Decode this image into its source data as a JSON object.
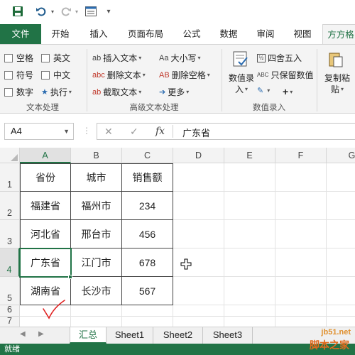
{
  "ribbon_tabs": [
    "文件",
    "开始",
    "插入",
    "页面布局",
    "公式",
    "数据",
    "审阅",
    "视图",
    "方方格"
  ],
  "text_group": {
    "checkboxes": [
      "空格",
      "英文",
      "符号",
      "中文",
      "数字"
    ],
    "execute_label": "执行",
    "label": "文本处理"
  },
  "advanced_group": {
    "insert_text": "插入文本",
    "delete_text": "删除文本",
    "cut_text": "截取文本",
    "case": "大小写",
    "delete_space": "删除空格",
    "more": "更多",
    "label": "高级文本处理",
    "icons": {
      "insert": "ab",
      "delete": "abc",
      "cut": "ab",
      "case": "Aa",
      "delete_space": "AB"
    }
  },
  "number_group": {
    "round": "四舍五入",
    "keep_value": "只保留数值",
    "value_entry_line1": "数值录",
    "value_entry_line2": "入",
    "plus": "+",
    "label": "数值录入",
    "keep_value_icon": "ABC"
  },
  "copy_paste": {
    "line1": "复制粘",
    "line2": "贴"
  },
  "formula_bar": {
    "cell_ref": "A4",
    "fx": "fx",
    "cancel": "✕",
    "confirm": "✓",
    "value": "广东省"
  },
  "grid": {
    "columns": [
      "A",
      "B",
      "C",
      "D",
      "E",
      "F",
      "G"
    ],
    "rows": [
      "1",
      "2",
      "3",
      "4",
      "5",
      "6",
      "7"
    ],
    "headers": [
      "省份",
      "城市",
      "销售额"
    ],
    "data": [
      [
        "福建省",
        "福州市",
        "234"
      ],
      [
        "河北省",
        "邢台市",
        "456"
      ],
      [
        "广东省",
        "江门市",
        "678"
      ],
      [
        "湖南省",
        "长沙市",
        "567"
      ]
    ],
    "selected_cell": "A4"
  },
  "sheets": [
    "汇总",
    "Sheet1",
    "Sheet2",
    "Sheet3"
  ],
  "active_sheet": "汇总",
  "status": "就绪",
  "watermark": {
    "line1": "jb51.net",
    "line2": "脚本之家"
  },
  "colors": {
    "accent": "#217346",
    "check_red": "#e02020"
  }
}
